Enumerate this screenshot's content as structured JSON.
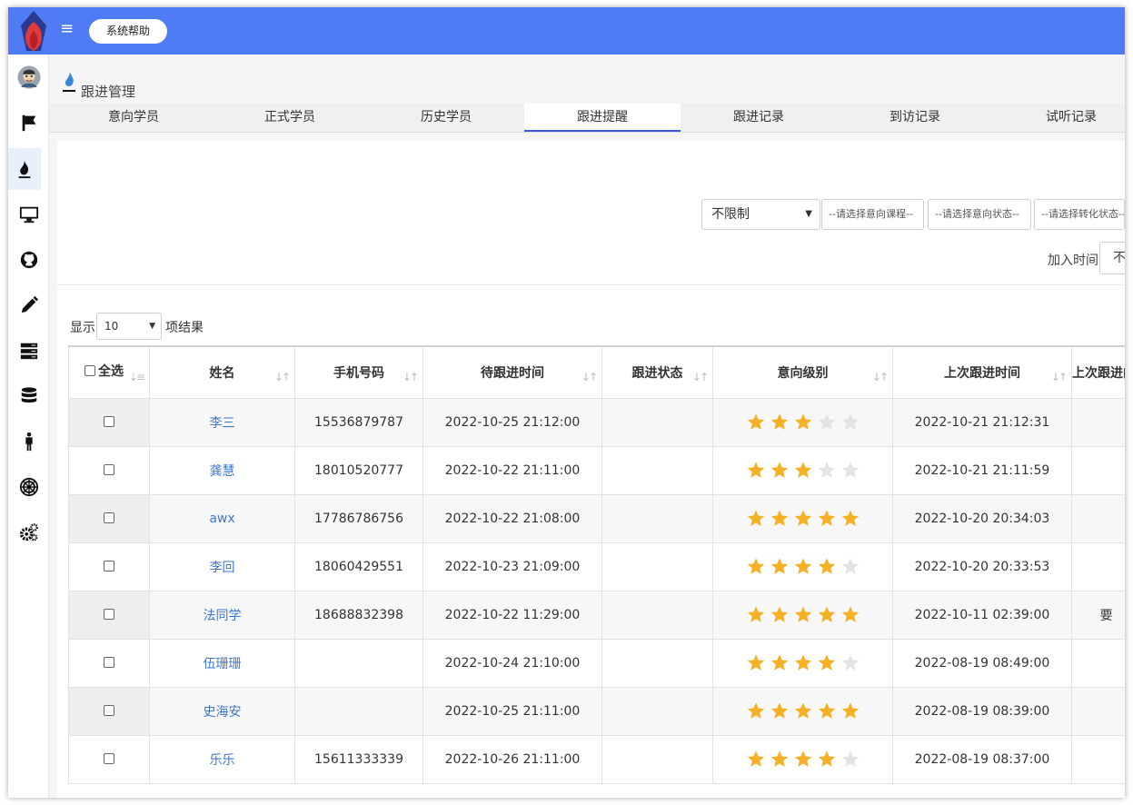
{
  "topbar": {
    "help_label": "系统帮助"
  },
  "sidebar": {
    "items": [
      {
        "icon": "avatar-icon"
      },
      {
        "icon": "flag-icon"
      },
      {
        "icon": "flame-icon",
        "active": true
      },
      {
        "icon": "monitor-icon"
      },
      {
        "icon": "github-icon"
      },
      {
        "icon": "pencil-icon"
      },
      {
        "icon": "server-icon"
      },
      {
        "icon": "database-icon"
      },
      {
        "icon": "person-icon"
      },
      {
        "icon": "empire-icon"
      },
      {
        "icon": "gears-icon"
      }
    ]
  },
  "page": {
    "title": "跟进管理"
  },
  "tabs": [
    "意向学员",
    "正式学员",
    "历史学员",
    "跟进提醒",
    "跟进记录",
    "到访记录",
    "试听记录"
  ],
  "active_tab": "跟进提醒",
  "filters": {
    "main_select": "不限制",
    "course_select": "--请选择意向课程--",
    "intent_select": "--请选择意向状态--",
    "convert_select": "--请选择转化状态--",
    "join_time_label": "加入时间",
    "join_time_value": "不限制"
  },
  "length": {
    "prefix": "显示",
    "value": "10",
    "suffix": "项结果"
  },
  "table": {
    "select_all": "全选",
    "columns": [
      "姓名",
      "手机号码",
      "待跟进时间",
      "跟进状态",
      "意向级别",
      "上次跟进时间",
      "上次跟进内容"
    ],
    "rows": [
      {
        "name": "李三",
        "phone": "15536879787",
        "due": "2022-10-25 21:12:00",
        "status": "",
        "level": 3,
        "last": "2022-10-21 21:12:31",
        "content": ""
      },
      {
        "name": "龚慧",
        "phone": "18010520777",
        "due": "2022-10-22 21:11:00",
        "status": "",
        "level": 3,
        "last": "2022-10-21 21:11:59",
        "content": ""
      },
      {
        "name": "awx",
        "phone": "17786786756",
        "due": "2022-10-22 21:08:00",
        "status": "",
        "level": 5,
        "last": "2022-10-20 20:34:03",
        "content": ""
      },
      {
        "name": "李回",
        "phone": "18060429551",
        "due": "2022-10-23 21:09:00",
        "status": "",
        "level": 4,
        "last": "2022-10-20 20:33:53",
        "content": ""
      },
      {
        "name": "法同学",
        "phone": "18688832398",
        "due": "2022-10-22 11:29:00",
        "status": "",
        "level": 5,
        "last": "2022-10-11 02:39:00",
        "content": "要"
      },
      {
        "name": "伍珊珊",
        "phone": "",
        "due": "2022-10-24 21:10:00",
        "status": "",
        "level": 4,
        "last": "2022-08-19 08:49:00",
        "content": ""
      },
      {
        "name": "史海安",
        "phone": "",
        "due": "2022-10-25 21:11:00",
        "status": "",
        "level": 5,
        "last": "2022-08-19 08:39:00",
        "content": ""
      },
      {
        "name": "乐乐",
        "phone": "15611333339",
        "due": "2022-10-26 21:11:00",
        "status": "",
        "level": 4,
        "last": "2022-08-19 08:37:00",
        "content": ""
      }
    ]
  },
  "colors": {
    "topbar": "#4f7cf5",
    "star_on": "#f5b026",
    "star_off": "#e3e3e3",
    "link": "#3e77d0"
  }
}
